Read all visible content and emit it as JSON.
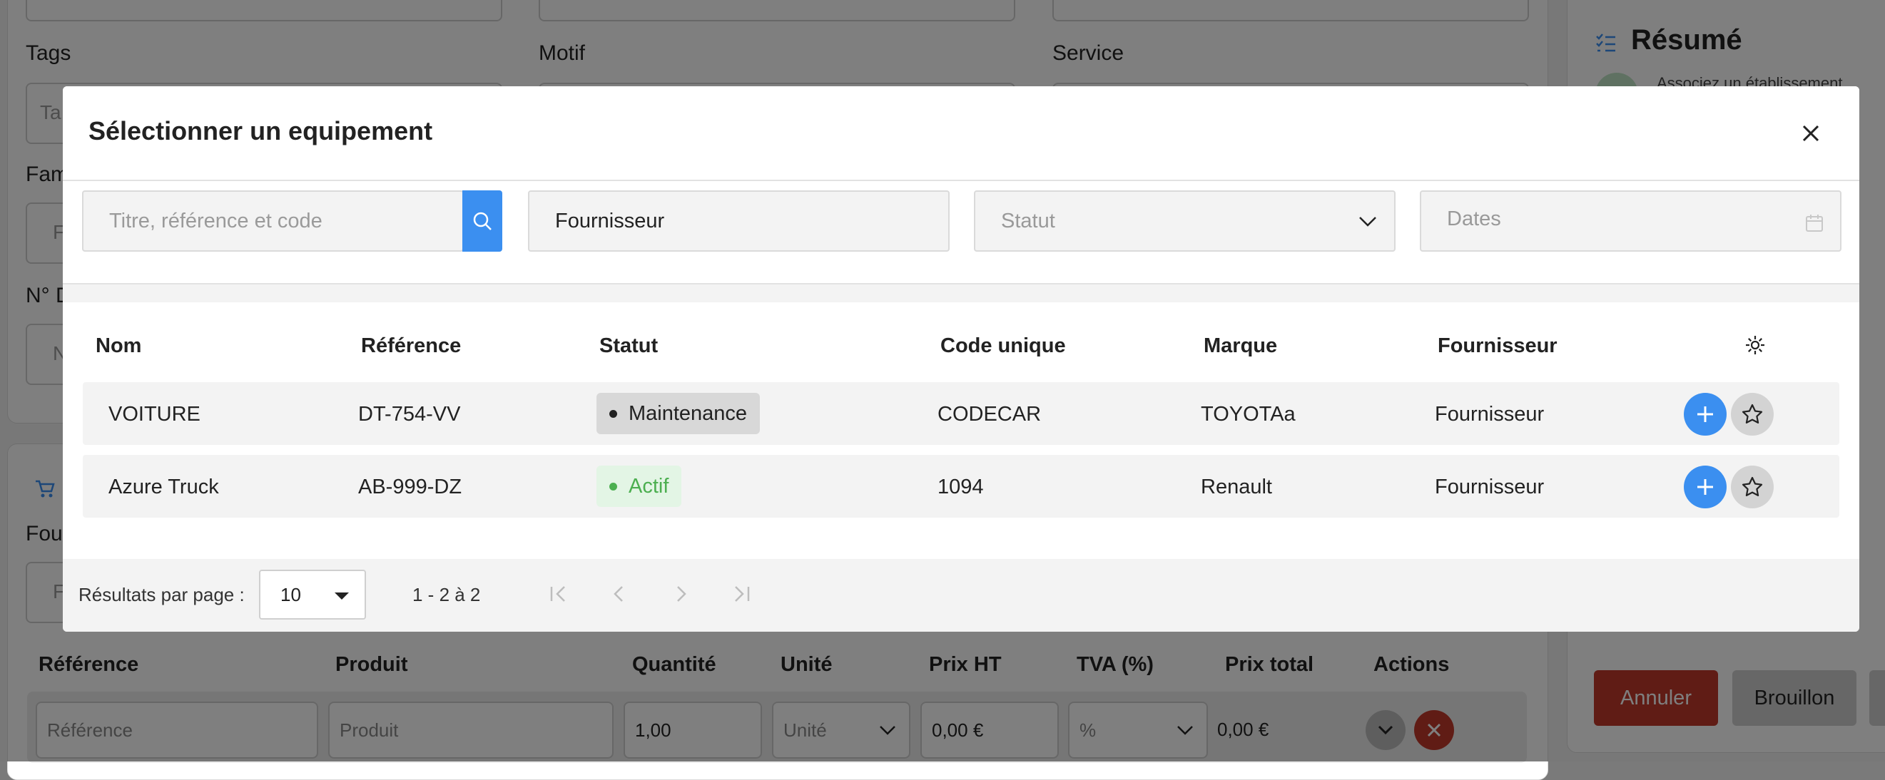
{
  "background": {
    "form_labels": {
      "tags": "Tags",
      "motif": "Motif",
      "service": "Service",
      "famille_partial": "Fam",
      "numero_partial": "N° D",
      "fournisseur_partial": "Four"
    },
    "form_placeholders": {
      "tags_partial": "Ta",
      "famille_partial": "F",
      "numero_partial": "N",
      "fournisseur_partial": "F"
    },
    "summary": {
      "title": "Résumé",
      "hint": "Associez un établissement"
    },
    "products_table": {
      "headers": [
        "Référence",
        "Produit",
        "Quantité",
        "Unité",
        "Prix HT",
        "TVA (%)",
        "Prix total",
        "Actions"
      ],
      "row": {
        "reference_placeholder": "Référence",
        "produit_placeholder": "Produit",
        "quantite": "1,00",
        "unite_placeholder": "Unité",
        "prix_ht": "0,00 €",
        "tva_placeholder": "%",
        "prix_total": "0,00 €"
      }
    },
    "buttons": {
      "cancel": "Annuler",
      "draft": "Brouillon"
    },
    "colors": {
      "cancel": "#c0392b",
      "draft": "#cfcfcf"
    }
  },
  "modal": {
    "title": "Sélectionner un equipement",
    "filters": {
      "search_placeholder": "Titre, référence et code",
      "supplier_value": "Fournisseur",
      "status_placeholder": "Statut",
      "dates_placeholder": "Dates"
    },
    "columns": [
      "Nom",
      "Référence",
      "Statut",
      "Code unique",
      "Marque",
      "Fournisseur"
    ],
    "rows": [
      {
        "nom": "VOITURE",
        "reference": "DT-754-VV",
        "statut": "Maintenance",
        "code": "CODECAR",
        "marque": "TOYOTAa",
        "fournisseur": "Fournisseur"
      },
      {
        "nom": "Azure Truck",
        "reference": "AB-999-DZ",
        "statut": "Actif",
        "code": "1094",
        "marque": "Renault",
        "fournisseur": "Fournisseur"
      }
    ],
    "pagination": {
      "per_page_label": "Résultats par page :",
      "per_page_value": "10",
      "range": "1 - 2 à 2"
    },
    "colors": {
      "accent": "#3b8ff0",
      "status_maintenance_bg": "#d8d8d8",
      "status_active_bg": "#e3f5e5",
      "status_active_text": "#4caf50"
    }
  }
}
